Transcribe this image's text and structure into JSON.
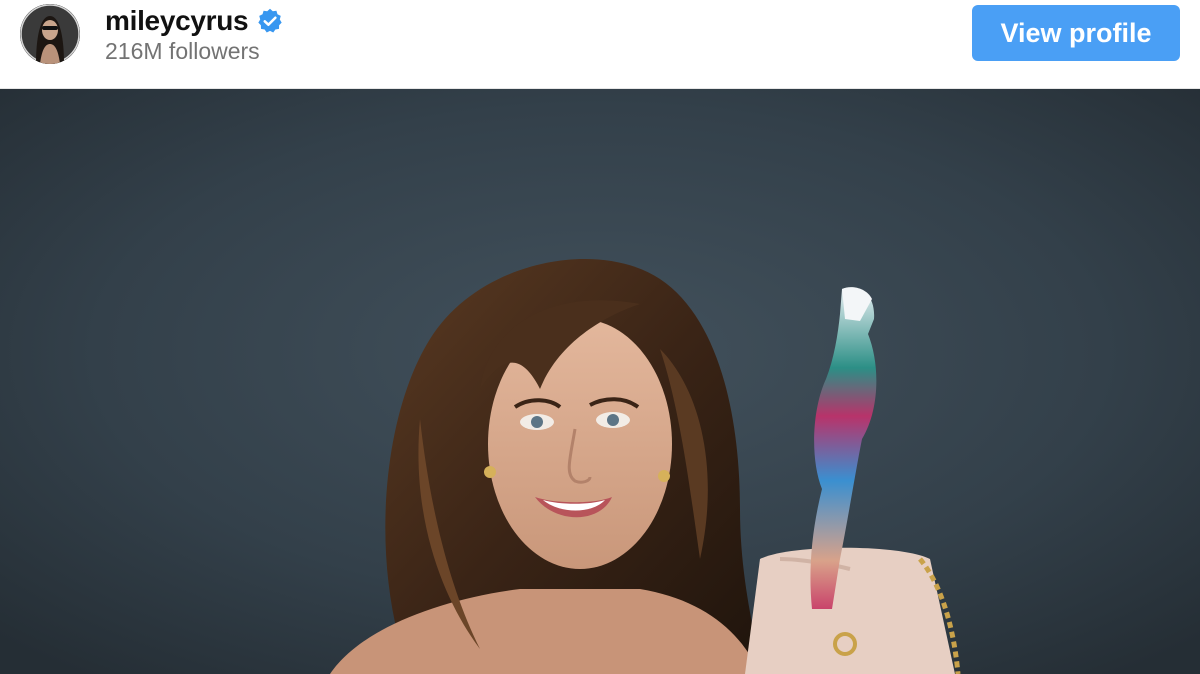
{
  "profile": {
    "username": "mileycyrus",
    "followers": "216M followers",
    "verified": true
  },
  "actions": {
    "view_profile_label": "View profile"
  },
  "colors": {
    "button_bg": "#4a9ff5",
    "verified_badge": "#3897f0",
    "photo_background": "#2f3b44"
  }
}
